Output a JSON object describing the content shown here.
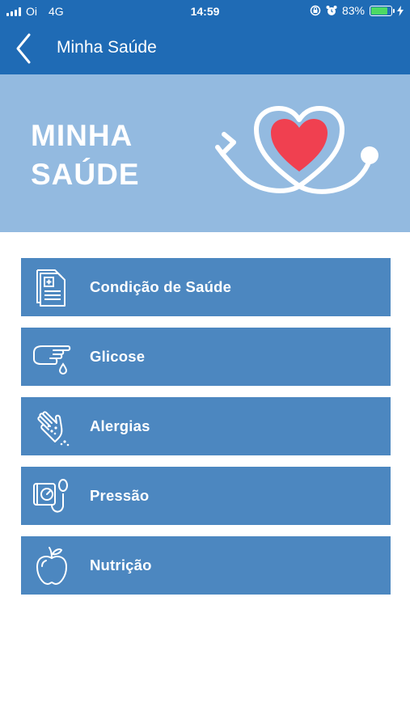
{
  "status_bar": {
    "carrier": "Oi",
    "network": "4G",
    "time": "14:59",
    "battery": "83%",
    "battery_level": 0.83
  },
  "nav": {
    "title": "Minha Saúde",
    "back_icon": "chevron-left-icon"
  },
  "banner": {
    "title_line1": "MINHA",
    "title_line2": "SAÚDE",
    "art_icon": "heart-stethoscope-icon",
    "heart_color": "#f04050"
  },
  "menu": {
    "items": [
      {
        "label": "Condição de Saúde",
        "icon": "medical-document-icon"
      },
      {
        "label": "Glicose",
        "icon": "finger-blood-drop-icon"
      },
      {
        "label": "Alergias",
        "icon": "allergy-hand-icon"
      },
      {
        "label": "Pressão",
        "icon": "blood-pressure-monitor-icon"
      },
      {
        "label": "Nutrição",
        "icon": "apple-icon"
      }
    ]
  },
  "colors": {
    "header": "#1f6bb5",
    "banner": "#93bae0",
    "menu_item": "#4c87c0"
  }
}
